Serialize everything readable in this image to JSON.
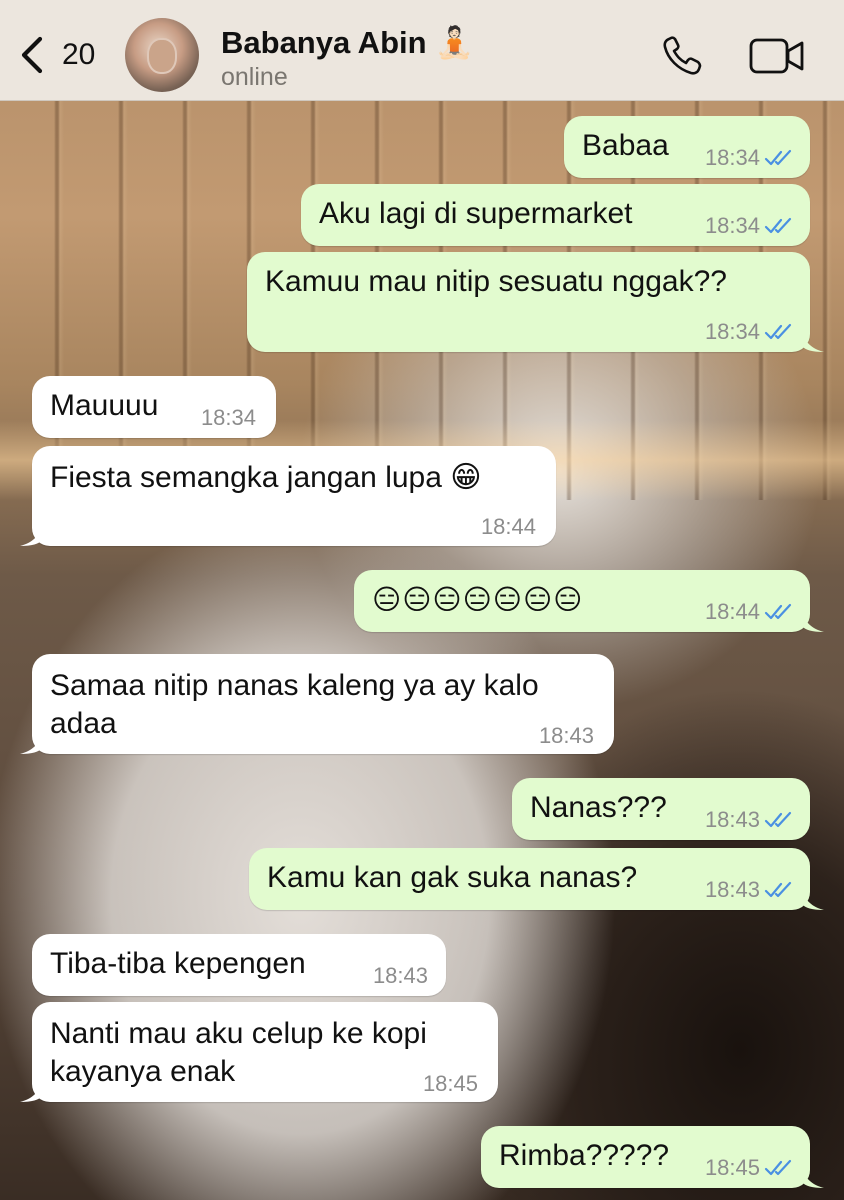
{
  "header": {
    "back_count": "20",
    "contact_name": "Babanya Abin",
    "name_emoji": "🧘🏻",
    "status": "online"
  },
  "colors": {
    "outgoing_bubble": "#e2fbcf",
    "incoming_bubble": "#ffffff",
    "read_ticks": "#4a90e2",
    "header_bg": "#ece6de"
  },
  "messages": [
    {
      "dir": "out",
      "text": "Babaa",
      "time": "18:34",
      "status": "read"
    },
    {
      "dir": "out",
      "text": "Aku lagi di supermarket",
      "time": "18:34",
      "status": "read"
    },
    {
      "dir": "out",
      "text": "Kamuu mau nitip sesuatu nggak??",
      "time": "18:34",
      "status": "read"
    },
    {
      "dir": "in",
      "text": "Mauuuu",
      "time": "18:34"
    },
    {
      "dir": "in",
      "text": "Fiesta semangka jangan lupa 😁",
      "time": "18:44"
    },
    {
      "dir": "out",
      "text": "😑😑😑😑😑😑😑",
      "time": "18:44",
      "status": "read"
    },
    {
      "dir": "in",
      "text": "Samaa nitip nanas kaleng ya ay kalo adaa",
      "line1": "Samaa nitip nanas kaleng ya ay kalo",
      "line2": "adaa",
      "time": "18:43"
    },
    {
      "dir": "out",
      "text": "Nanas???",
      "time": "18:43",
      "status": "read"
    },
    {
      "dir": "out",
      "text": "Kamu kan gak suka nanas?",
      "time": "18:43",
      "status": "read"
    },
    {
      "dir": "in",
      "text": "Tiba-tiba kepengen",
      "time": "18:43"
    },
    {
      "dir": "in",
      "text": "Nanti mau aku celup ke kopi kayanya enak",
      "line1": "Nanti mau aku celup ke kopi",
      "line2": "kayanya enak",
      "time": "18:45"
    },
    {
      "dir": "out",
      "text": "Rimba?????",
      "time": "18:45",
      "status": "read"
    }
  ]
}
